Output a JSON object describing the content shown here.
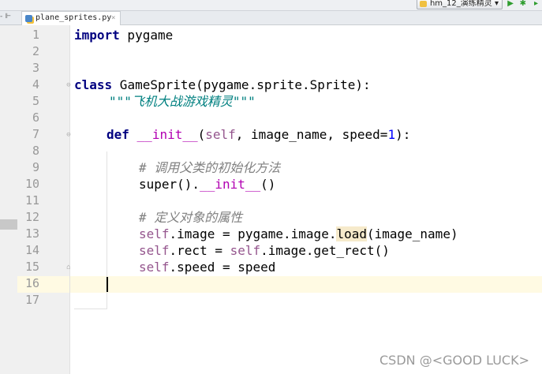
{
  "toolbar": {
    "run_config": "hm_12_演练精灵",
    "run_config_arrow": "▾",
    "run_icon": "▶",
    "debug_icon": "✱",
    "coverage_icon": "▸"
  },
  "tabs": [
    {
      "label": "plane_sprites.py",
      "close": "×",
      "icon": "python-file-icon",
      "active": true
    }
  ],
  "tab_left_glyph": "- ⊩",
  "editor": {
    "current_line": 16,
    "line_numbers": [
      "1",
      "2",
      "3",
      "4",
      "5",
      "6",
      "7",
      "8",
      "9",
      "10",
      "11",
      "12",
      "13",
      "14",
      "15",
      "16",
      "17"
    ],
    "lines": {
      "l1_kw": "import",
      "l1_rest": " pygame",
      "l4_kw": "class",
      "l4_rest": " GameSprite(pygame.sprite.Sprite):",
      "l5_doc": "\"\"\"飞机大战游戏精灵\"\"\"",
      "l7_kw": "def",
      "l7_name": "__init__",
      "l7_open": "(",
      "l7_self": "self",
      "l7_mid": ", image_name, speed=",
      "l7_num": "1",
      "l7_close": "):",
      "l9_comment": "# 调用父类的初始化方法",
      "l10_pre": "super().",
      "l10_dunder": "__init__",
      "l10_post": "()",
      "l12_comment": "# 定义对象的属性",
      "l13_self": "self",
      "l13_mid": ".image = pygame.image.",
      "l13_hl": "load",
      "l13_post": "(image_name)",
      "l14_self1": "self",
      "l14_mid": ".rect = ",
      "l14_self2": "self",
      "l14_post": ".image.get_rect()",
      "l15_self": "self",
      "l15_post": ".speed = speed"
    }
  },
  "watermark": "CSDN @<GOOD LUCK>"
}
